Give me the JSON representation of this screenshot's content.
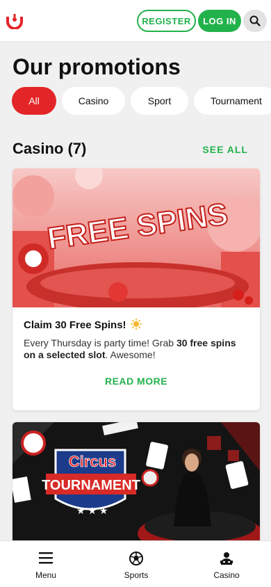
{
  "header": {
    "register_label": "REGISTER",
    "login_label": "LOG IN",
    "search_icon": "search-icon",
    "brand_color": "#e42528",
    "accent_color": "#22b24c"
  },
  "page": {
    "title": "Our promotions"
  },
  "filters": [
    {
      "label": "All",
      "active": true
    },
    {
      "label": "Casino",
      "active": false
    },
    {
      "label": "Sport",
      "active": false
    },
    {
      "label": "Tournament",
      "active": false
    }
  ],
  "section": {
    "title": "Casino (7)",
    "see_all": "SEE ALL"
  },
  "promos": [
    {
      "image_text": "FREE SPINS",
      "title": "Claim 30 Free Spins!",
      "desc_pre": "Every Thursday is party time! Grab ",
      "desc_bold": "30 free spins on a selected slot",
      "desc_post": ". Awesome!",
      "cta": "READ MORE"
    },
    {
      "image_brand": "Circus",
      "image_text": "TOURNAMENT"
    }
  ],
  "bottom_nav": [
    {
      "label": "Menu",
      "icon": "menu-icon"
    },
    {
      "label": "Sports",
      "icon": "sports-ball-icon"
    },
    {
      "label": "Casino",
      "icon": "casino-dealer-icon"
    }
  ]
}
